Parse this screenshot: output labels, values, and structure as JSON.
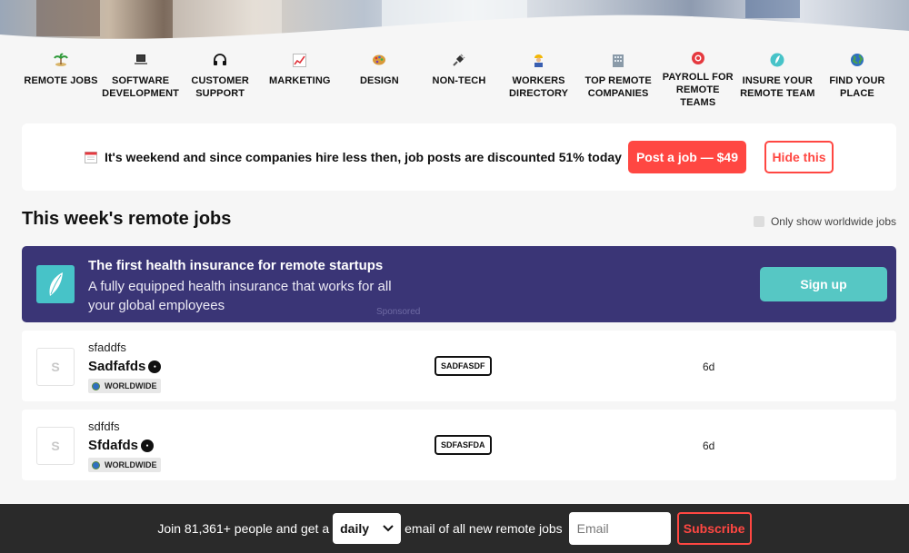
{
  "categories": [
    {
      "label": "REMOTE JOBS",
      "icon": "palm-island-icon"
    },
    {
      "label": "SOFTWARE\nDEVELOPMENT",
      "icon": "laptop-icon"
    },
    {
      "label": "CUSTOMER\nSUPPORT",
      "icon": "headphones-icon"
    },
    {
      "label": "MARKETING",
      "icon": "chart-icon"
    },
    {
      "label": "DESIGN",
      "icon": "palette-icon"
    },
    {
      "label": "NON-TECH",
      "icon": "plug-icon"
    },
    {
      "label": "WORKERS\nDIRECTORY",
      "icon": "worker-icon"
    },
    {
      "label": "TOP REMOTE\nCOMPANIES",
      "icon": "building-icon"
    },
    {
      "label": "PAYROLL FOR\nREMOTE TEAMS",
      "icon": "lifebuoy-icon"
    },
    {
      "label": "INSURE YOUR\nREMOTE TEAM",
      "icon": "feather-icon"
    },
    {
      "label": "FIND YOUR\nPLACE",
      "icon": "globe-icon"
    }
  ],
  "promo": {
    "text": "It's weekend and since companies hire less then, job posts are discounted 51% today",
    "post_button": "Post a job — $49",
    "hide_button": "Hide this",
    "icon": "calendar-icon"
  },
  "section": {
    "title": "This week's remote jobs",
    "worldwide_toggle": "Only show worldwide jobs"
  },
  "ad": {
    "headline": "The first health insurance for remote startups",
    "description": "A fully equipped health insurance that works for all your global employees",
    "sponsored": "Sponsored",
    "signup": "Sign up"
  },
  "jobs": [
    {
      "logo_letter": "S",
      "company": "sfaddfs",
      "title": "Sadfafds",
      "region": "WORLDWIDE",
      "tag": "SADFASDF",
      "age": "6d"
    },
    {
      "logo_letter": "S",
      "company": "sdfdfs",
      "title": "Sfdafds",
      "region": "WORLDWIDE",
      "tag": "SDFASFDA",
      "age": "6d"
    }
  ],
  "footer": {
    "text_before": "Join 81,361+ people and get a",
    "frequency": "daily",
    "text_after": "email of all new remote jobs",
    "email_placeholder": "Email",
    "subscribe": "Subscribe"
  },
  "colors": {
    "accent_red": "#ff4742",
    "ad_purple": "#3a3576",
    "ad_teal": "#56c7c4",
    "footer_bg": "#2a2a2a"
  }
}
